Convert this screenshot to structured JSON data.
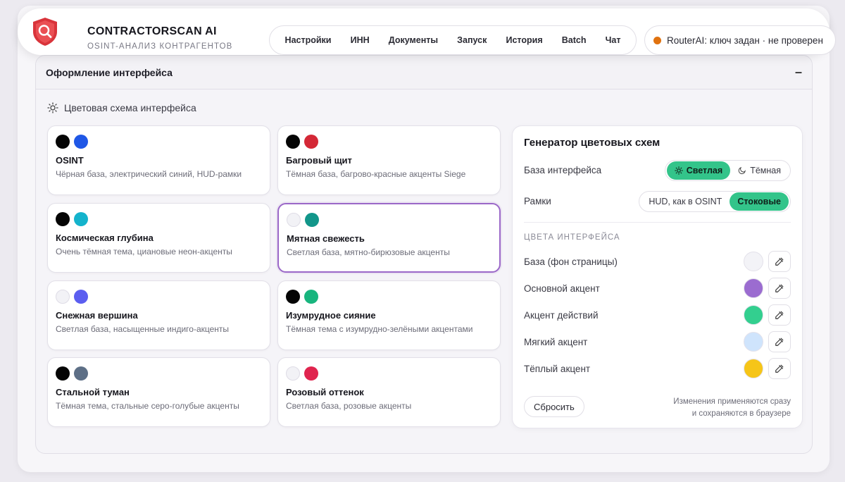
{
  "header": {
    "title": "CONTRACTORSCAN AI",
    "subtitle": "OSINT-АНАЛИЗ КОНТРАГЕНТОВ",
    "nav": [
      "Настройки",
      "ИНН",
      "Документы",
      "Запуск",
      "История",
      "Batch",
      "Чат"
    ],
    "status": "RouterAI: ключ задан · не проверен",
    "status_color": "#e0720f"
  },
  "panel": {
    "title": "Оформление интерфейса",
    "collapse": "–",
    "scheme_label": "Цветовая схема интерфейса"
  },
  "themes": [
    {
      "name": "OSINT",
      "desc": "Чёрная база, электрический синий, HUD-рамки",
      "c1": "#050505",
      "c2": "#1f57e6",
      "selected": false
    },
    {
      "name": "Багровый щит",
      "desc": "Тёмная база, багрово-красные акценты Siege",
      "c1": "#050505",
      "c2": "#d42836",
      "selected": false
    },
    {
      "name": "Космическая глубина",
      "desc": "Очень тёмная тема, циановые неон-акценты",
      "c1": "#050505",
      "c2": "#14b3cc",
      "selected": false
    },
    {
      "name": "Мятная свежесть",
      "desc": "Светлая база, мятно-бирюзовые акценты",
      "c1": "#f2f2f6",
      "c2": "#12968a",
      "selected": true
    },
    {
      "name": "Снежная вершина",
      "desc": "Светлая база, насыщенные индиго-акценты",
      "c1": "#f2f2f6",
      "c2": "#5b5ef0",
      "selected": false
    },
    {
      "name": "Изумрудное сияние",
      "desc": "Тёмная тема с изумрудно-зелёными акцентами",
      "c1": "#050505",
      "c2": "#18b57e",
      "selected": false
    },
    {
      "name": "Стальной туман",
      "desc": "Тёмная тема, стальные серо-голубые акценты",
      "c1": "#050505",
      "c2": "#5d6f86",
      "selected": false
    },
    {
      "name": "Розовый оттенок",
      "desc": "Светлая база, розовые акценты",
      "c1": "#f2f2f6",
      "c2": "#e0244e",
      "selected": false
    }
  ],
  "generator": {
    "title": "Генератор цветовых схем",
    "base_label": "База интерфейса",
    "base_light": "Светлая",
    "base_dark": "Тёмная",
    "frames_label": "Рамки",
    "frames_hud": "HUD, как в OSINT",
    "frames_stock": "Стоковые",
    "section": "ЦВЕТА ИНТЕРФЕЙСА",
    "colors": [
      {
        "label": "База (фон страницы)",
        "color": "#f3f3f7"
      },
      {
        "label": "Основной акцент",
        "color": "#9b6cd0"
      },
      {
        "label": "Акцент действий",
        "color": "#33cf8f"
      },
      {
        "label": "Мягкий акцент",
        "color": "#cfe4fc"
      },
      {
        "label": "Тёплый акцент",
        "color": "#f6c518"
      }
    ],
    "reset": "Сбросить",
    "note_line1": "Изменения применяются сразу",
    "note_line2": "и сохраняются в браузере"
  }
}
